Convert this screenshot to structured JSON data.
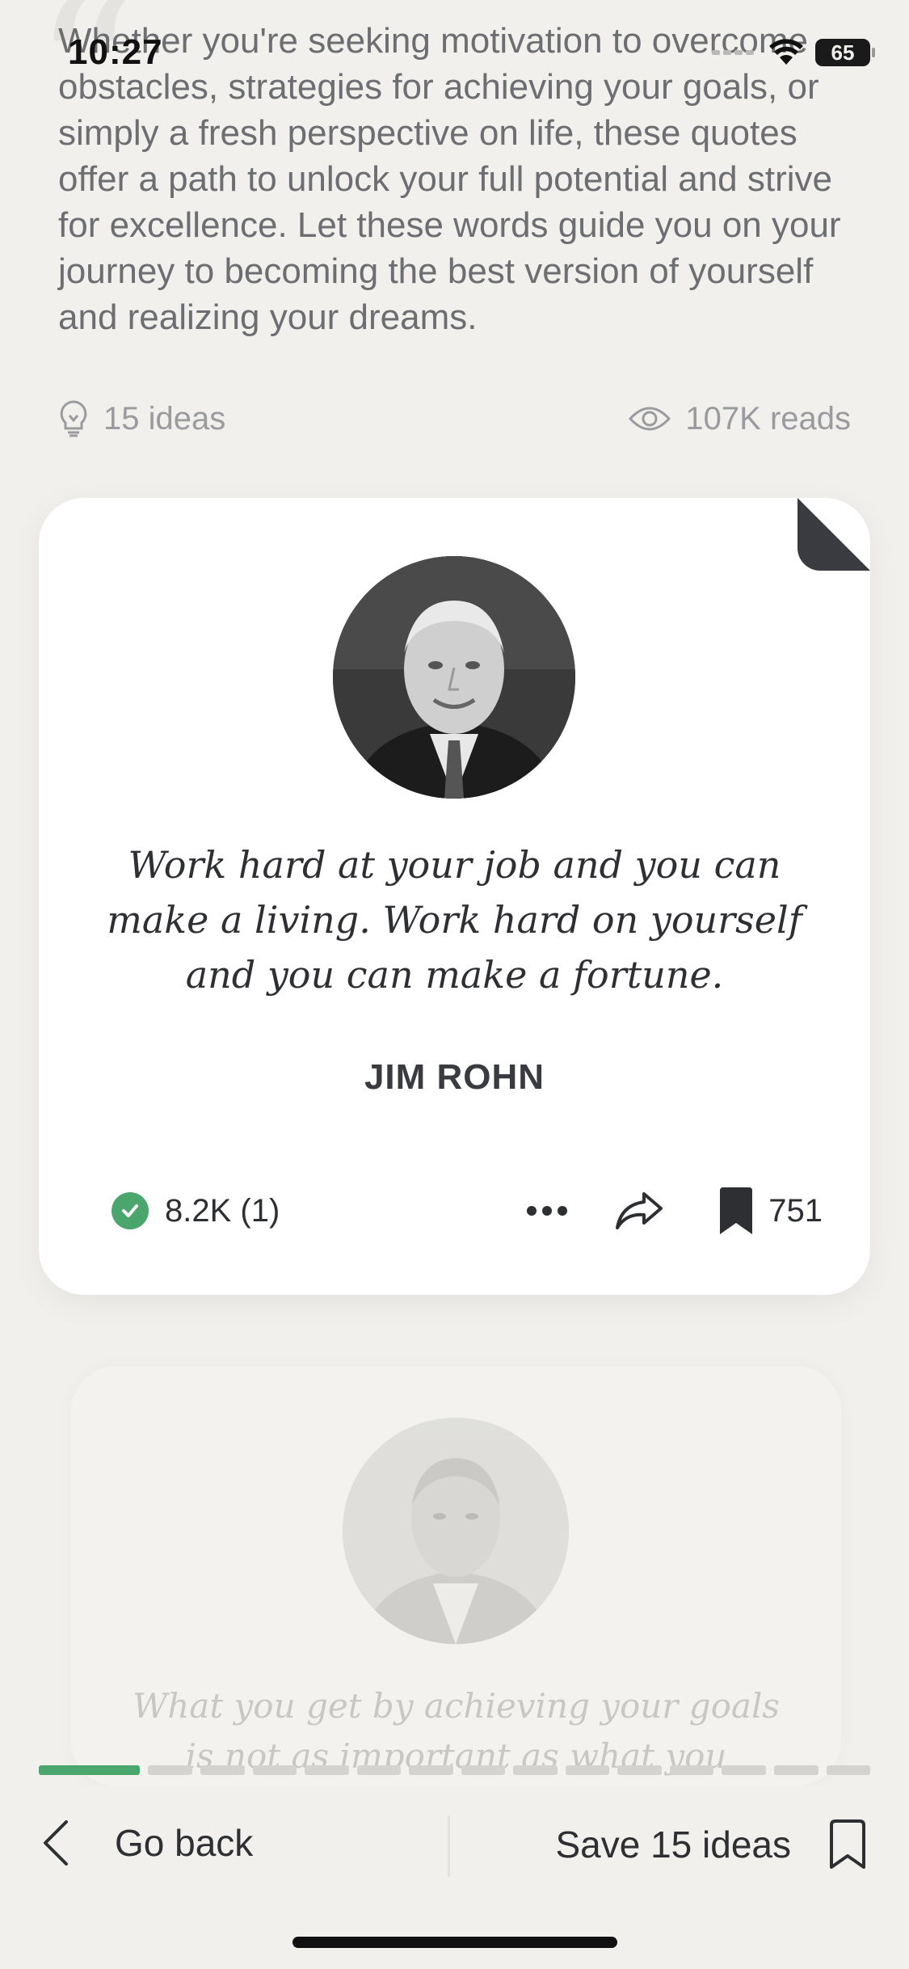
{
  "status_bar": {
    "time": "10:27",
    "battery": "65"
  },
  "intro": {
    "text": "Whether you're seeking motivation to overcome obstacles, strategies for achieving your goals, or simply a fresh perspective on life, these quotes offer a path to unlock your full potential and strive for excellence. Let these words guide you on your journey to becoming the best version of yourself and realizing your dreams."
  },
  "meta": {
    "ideas": "15 ideas",
    "reads": "107K reads"
  },
  "card": {
    "quote": "Work hard at your job and you can make a living. Work hard on yourself and you can make a fortune.",
    "author": "JIM ROHN",
    "checks": "8.2K (1)",
    "bookmarks": "751"
  },
  "next_card": {
    "quote": "What you get by achieving your goals is not as important as what you become by"
  },
  "progress": {
    "current": 1,
    "total": 15
  },
  "bottom_bar": {
    "back_label": "Go back",
    "save_label": "Save 15 ideas"
  },
  "colors": {
    "accent": "#4aa66c",
    "background": "#f1f0ed",
    "card": "#ffffff",
    "text": "#2e2f33"
  }
}
